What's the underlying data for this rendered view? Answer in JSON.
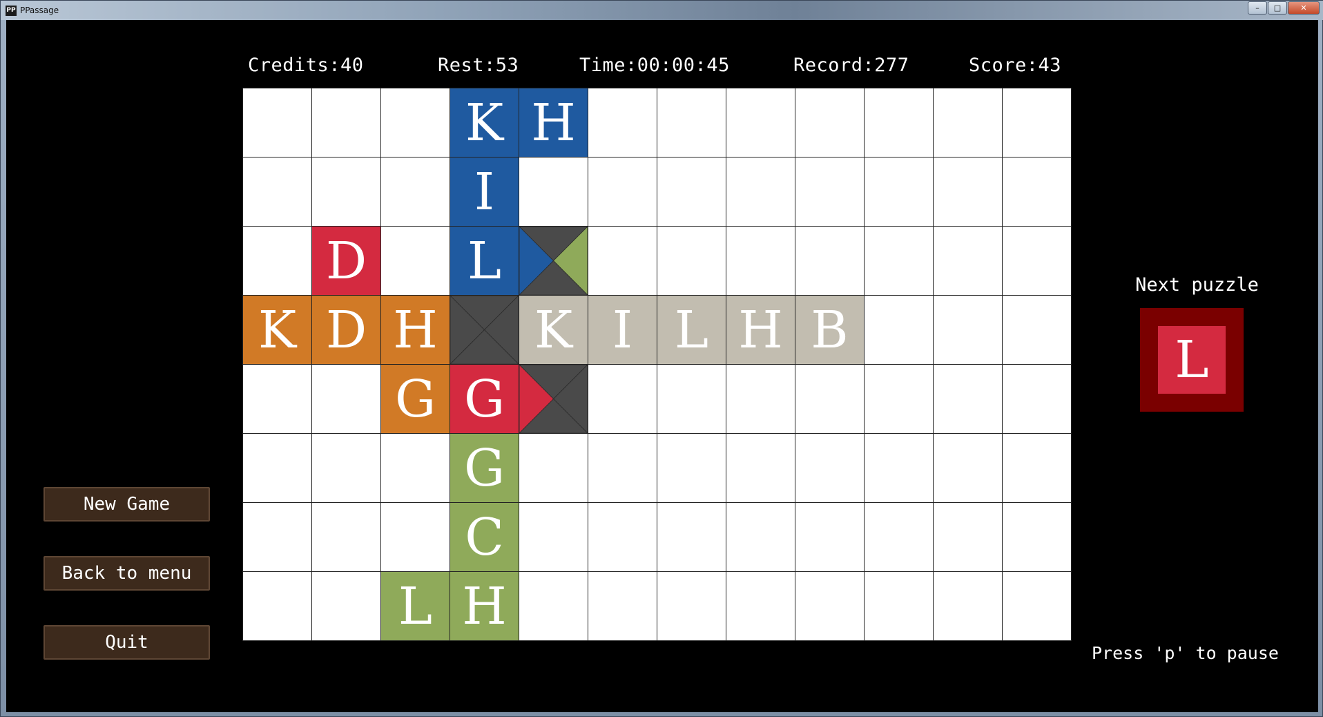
{
  "window": {
    "title": "PPassage",
    "icon_text": "PP",
    "min_glyph": "–",
    "max_glyph": "□",
    "close_glyph": "✕"
  },
  "hud": {
    "credits": "Credits:40",
    "rest": "Rest:53",
    "time": "Time:00:00:45",
    "record": "Record:277",
    "score": "Score:43"
  },
  "colors": {
    "blue": "#1f5aa0",
    "red": "#d42a40",
    "orange": "#d17a26",
    "green": "#8faa5a",
    "gray": "#c2bdb0",
    "dark": "#4a4a4a",
    "next_bg": "#7a0000",
    "button_bg": "#3d2a1c"
  },
  "board": {
    "cols": 12,
    "rows": 8,
    "tiles": [
      {
        "row": 0,
        "col": 3,
        "letter": "K",
        "color": "blue"
      },
      {
        "row": 0,
        "col": 4,
        "letter": "H",
        "color": "blue"
      },
      {
        "row": 1,
        "col": 3,
        "letter": "I",
        "color": "blue"
      },
      {
        "row": 2,
        "col": 1,
        "letter": "D",
        "color": "red"
      },
      {
        "row": 2,
        "col": 3,
        "letter": "L",
        "color": "blue"
      },
      {
        "row": 2,
        "col": 4,
        "letter": "",
        "color": "dark",
        "wedges": {
          "left": "blue",
          "right": "green"
        }
      },
      {
        "row": 3,
        "col": 0,
        "letter": "K",
        "color": "orange"
      },
      {
        "row": 3,
        "col": 1,
        "letter": "D",
        "color": "orange"
      },
      {
        "row": 3,
        "col": 2,
        "letter": "H",
        "color": "orange"
      },
      {
        "row": 3,
        "col": 3,
        "letter": "",
        "color": "dark",
        "wedges": {}
      },
      {
        "row": 3,
        "col": 4,
        "letter": "K",
        "color": "gray"
      },
      {
        "row": 3,
        "col": 5,
        "letter": "I",
        "color": "gray"
      },
      {
        "row": 3,
        "col": 6,
        "letter": "L",
        "color": "gray"
      },
      {
        "row": 3,
        "col": 7,
        "letter": "H",
        "color": "gray"
      },
      {
        "row": 3,
        "col": 8,
        "letter": "B",
        "color": "gray"
      },
      {
        "row": 4,
        "col": 2,
        "letter": "G",
        "color": "orange"
      },
      {
        "row": 4,
        "col": 3,
        "letter": "G",
        "color": "red"
      },
      {
        "row": 4,
        "col": 4,
        "letter": "",
        "color": "dark",
        "wedges": {
          "left": "red"
        }
      },
      {
        "row": 5,
        "col": 3,
        "letter": "G",
        "color": "green"
      },
      {
        "row": 6,
        "col": 3,
        "letter": "C",
        "color": "green"
      },
      {
        "row": 7,
        "col": 2,
        "letter": "L",
        "color": "green"
      },
      {
        "row": 7,
        "col": 3,
        "letter": "H",
        "color": "green"
      }
    ]
  },
  "next_puzzle": {
    "label": "Next puzzle",
    "letter": "L",
    "color": "red"
  },
  "pause_hint": "Press 'p' to pause",
  "menu": {
    "new_game": "New Game",
    "back_to_menu": "Back to menu",
    "quit": "Quit"
  }
}
